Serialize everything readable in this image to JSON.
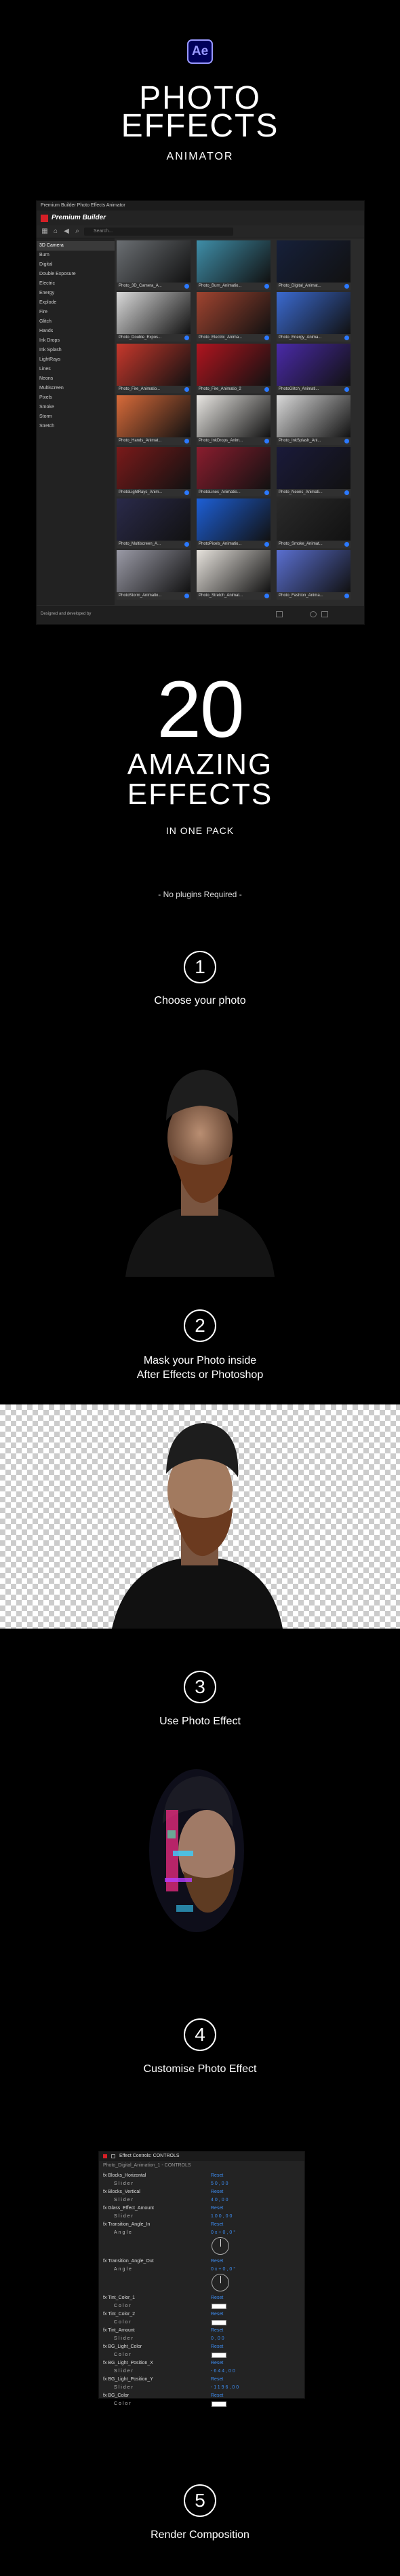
{
  "header": {
    "app_icon_text": "Ae",
    "title_line1": "PHOTO",
    "title_line2": "EFFECTS",
    "subtitle": "ANIMATOR"
  },
  "panel": {
    "tab_title": "Premium Builder Photo Effects Animator",
    "brand": "Premium Builder",
    "search_placeholder": "Search...",
    "categories": [
      "3D Camera",
      "Burn",
      "Digital",
      "Double Exposure",
      "Electric",
      "Energy",
      "Explode",
      "Fire",
      "Glitch",
      "Hands",
      "Ink Drops",
      "Ink Splash",
      "LightRays",
      "Lines",
      "Neons",
      "Multiscreen",
      "Pixels",
      "Smoke",
      "Storm",
      "Stretch"
    ],
    "thumbnails": [
      {
        "label": "Photo_3D_Camera_A...",
        "color": "#6b6f73"
      },
      {
        "label": "Photo_Burn_Animatio...",
        "color": "#3f8ea8"
      },
      {
        "label": "Photo_Digital_Animat...",
        "color": "#16203a"
      },
      {
        "label": "Photo_Double_Expos...",
        "color": "#d9d9d9"
      },
      {
        "label": "Photo_Electric_Anima...",
        "color": "#a04430"
      },
      {
        "label": "Photo_Energy_Anima...",
        "color": "#3b6ad0"
      },
      {
        "label": "Photo_Fire_Animatio...",
        "color": "#c7382c"
      },
      {
        "label": "Photo_Fire_Animatio_2",
        "color": "#b0151f"
      },
      {
        "label": "PhotoGlitch_Animati...",
        "color": "#4a2aa8"
      },
      {
        "label": "Photo_Hands_Animat...",
        "color": "#d86b3a"
      },
      {
        "label": "Photo_InkDrops_Anim...",
        "color": "#e8e6e2"
      },
      {
        "label": "Photo_InkSplash_Ani...",
        "color": "#d9d9d9"
      },
      {
        "label": "PhotoLightRays_Anim...",
        "color": "#7a1a1a"
      },
      {
        "label": "PhotoLines_Animatio...",
        "color": "#8a1d2e"
      },
      {
        "label": "Photo_Neons_Animati...",
        "color": "#1a1a3a"
      },
      {
        "label": "Photo_Multiscreen_A...",
        "color": "#2a2a4a"
      },
      {
        "label": "PhotoPixels_Animatio...",
        "color": "#1d5fd6"
      },
      {
        "label": "Photo_Smoke_Animat...",
        "color": "#2a2a2a"
      },
      {
        "label": "PhotoStorm_Animatio...",
        "color": "#9a9aa6"
      },
      {
        "label": "Photo_Stretch_Animat...",
        "color": "#e6e2dc"
      },
      {
        "label": "Photo_Fashion_Anima...",
        "color": "#5a6fd0"
      }
    ],
    "footer_text": "Designed and developed by"
  },
  "promo": {
    "count": "20",
    "line1": "AMAZING",
    "line2": "EFFECTS",
    "line3": "IN ONE PACK",
    "note": "- No plugins Required -"
  },
  "steps": [
    {
      "num": "1",
      "label": "Choose your photo"
    },
    {
      "num": "2",
      "label": "Mask your Photo inside",
      "label2": "After Effects or Photoshop"
    },
    {
      "num": "3",
      "label": "Use Photo Effect"
    },
    {
      "num": "4",
      "label": "Customise Photo Effect"
    },
    {
      "num": "5",
      "label": "Render Composition"
    }
  ],
  "effect_controls": {
    "title": "Effect Controls: CONTROLS",
    "layer": "Photo_Digital_Animation_1 - CONTROLS",
    "rows": [
      {
        "name": "fx  Blocks_Horizontal",
        "value": "Reset",
        "type": "fx"
      },
      {
        "name": "Slider",
        "value": "50,00",
        "type": "sub"
      },
      {
        "name": "fx  Blocks_Vertical",
        "value": "Reset",
        "type": "fx"
      },
      {
        "name": "Slider",
        "value": "40,00",
        "type": "sub"
      },
      {
        "name": "fx  Glass_Effect_Amount",
        "value": "Reset",
        "type": "fx"
      },
      {
        "name": "Slider",
        "value": "100,00",
        "type": "sub"
      },
      {
        "name": "fx  Transition_Angle_In",
        "value": "Reset",
        "type": "fx"
      },
      {
        "name": "Angle",
        "value": "0x+0,0°",
        "type": "sub"
      },
      {
        "name": "fx  Transition_Angle_Out",
        "value": "Reset",
        "type": "fx"
      },
      {
        "name": "Angle",
        "value": "0x+0,0°",
        "type": "sub"
      },
      {
        "name": "fx  Tint_Color_1",
        "value": "Reset",
        "type": "fx"
      },
      {
        "name": "Color",
        "value": "",
        "type": "sub"
      },
      {
        "name": "fx  Tint_Color_2",
        "value": "Reset",
        "type": "fx"
      },
      {
        "name": "Color",
        "value": "",
        "type": "sub"
      },
      {
        "name": "fx  Tint_Amount",
        "value": "Reset",
        "type": "fx"
      },
      {
        "name": "Slider",
        "value": "0,00",
        "type": "sub"
      },
      {
        "name": "fx  BG_Light_Color",
        "value": "Reset",
        "type": "fx"
      },
      {
        "name": "Color",
        "value": "",
        "type": "sub"
      },
      {
        "name": "fx  BG_Light_Position_X",
        "value": "Reset",
        "type": "fx"
      },
      {
        "name": "Slider",
        "value": "-644,00",
        "type": "sub"
      },
      {
        "name": "fx  BG_Light_Position_Y",
        "value": "Reset",
        "type": "fx"
      },
      {
        "name": "Slider",
        "value": "-1196,00",
        "type": "sub"
      },
      {
        "name": "fx  BG_Color",
        "value": "Reset",
        "type": "fx"
      },
      {
        "name": "Color",
        "value": "",
        "type": "sub"
      }
    ]
  }
}
